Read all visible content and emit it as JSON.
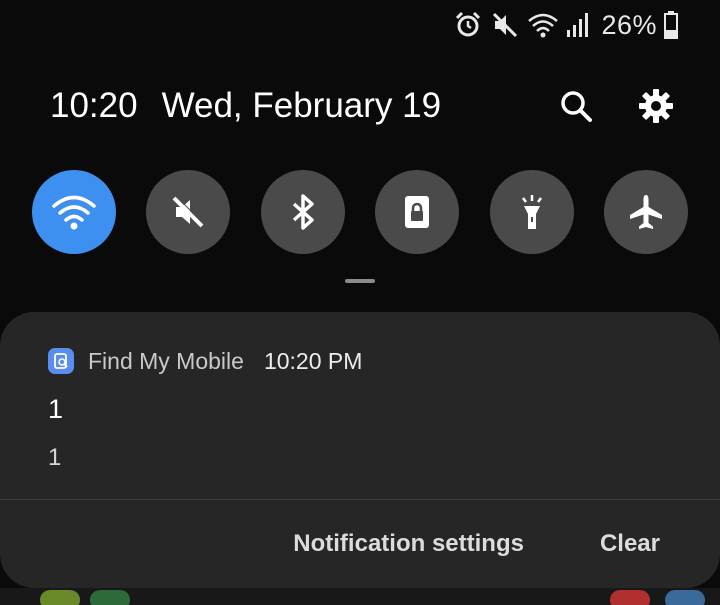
{
  "status_bar": {
    "icons": [
      "alarm-icon",
      "mute-icon",
      "wifi-icon",
      "signal-icon",
      "battery-icon"
    ],
    "battery_percent": "26%"
  },
  "header": {
    "time": "10:20",
    "date": "Wed, February 19",
    "actions": [
      "search-icon",
      "gear-icon"
    ]
  },
  "quick_settings": [
    {
      "name": "wifi",
      "icon": "wifi-icon",
      "active": true
    },
    {
      "name": "sound",
      "icon": "mute-icon",
      "active": false
    },
    {
      "name": "bluetooth",
      "icon": "bluetooth-icon",
      "active": false
    },
    {
      "name": "screen-lock",
      "icon": "lock-icon",
      "active": false
    },
    {
      "name": "flashlight",
      "icon": "flashlight-icon",
      "active": false
    },
    {
      "name": "airplane-mode",
      "icon": "airplane-icon",
      "active": false
    }
  ],
  "notification": {
    "app_name": "Find My Mobile",
    "time": "10:20 PM",
    "title": "1",
    "body": "1",
    "actions": {
      "settings_label": "Notification settings",
      "clear_label": "Clear"
    }
  },
  "colors": {
    "accent": "#3d8ff0",
    "toggle_off": "#4a4a4a",
    "card_bg": "#262626",
    "app_icon": "#5b8def"
  }
}
